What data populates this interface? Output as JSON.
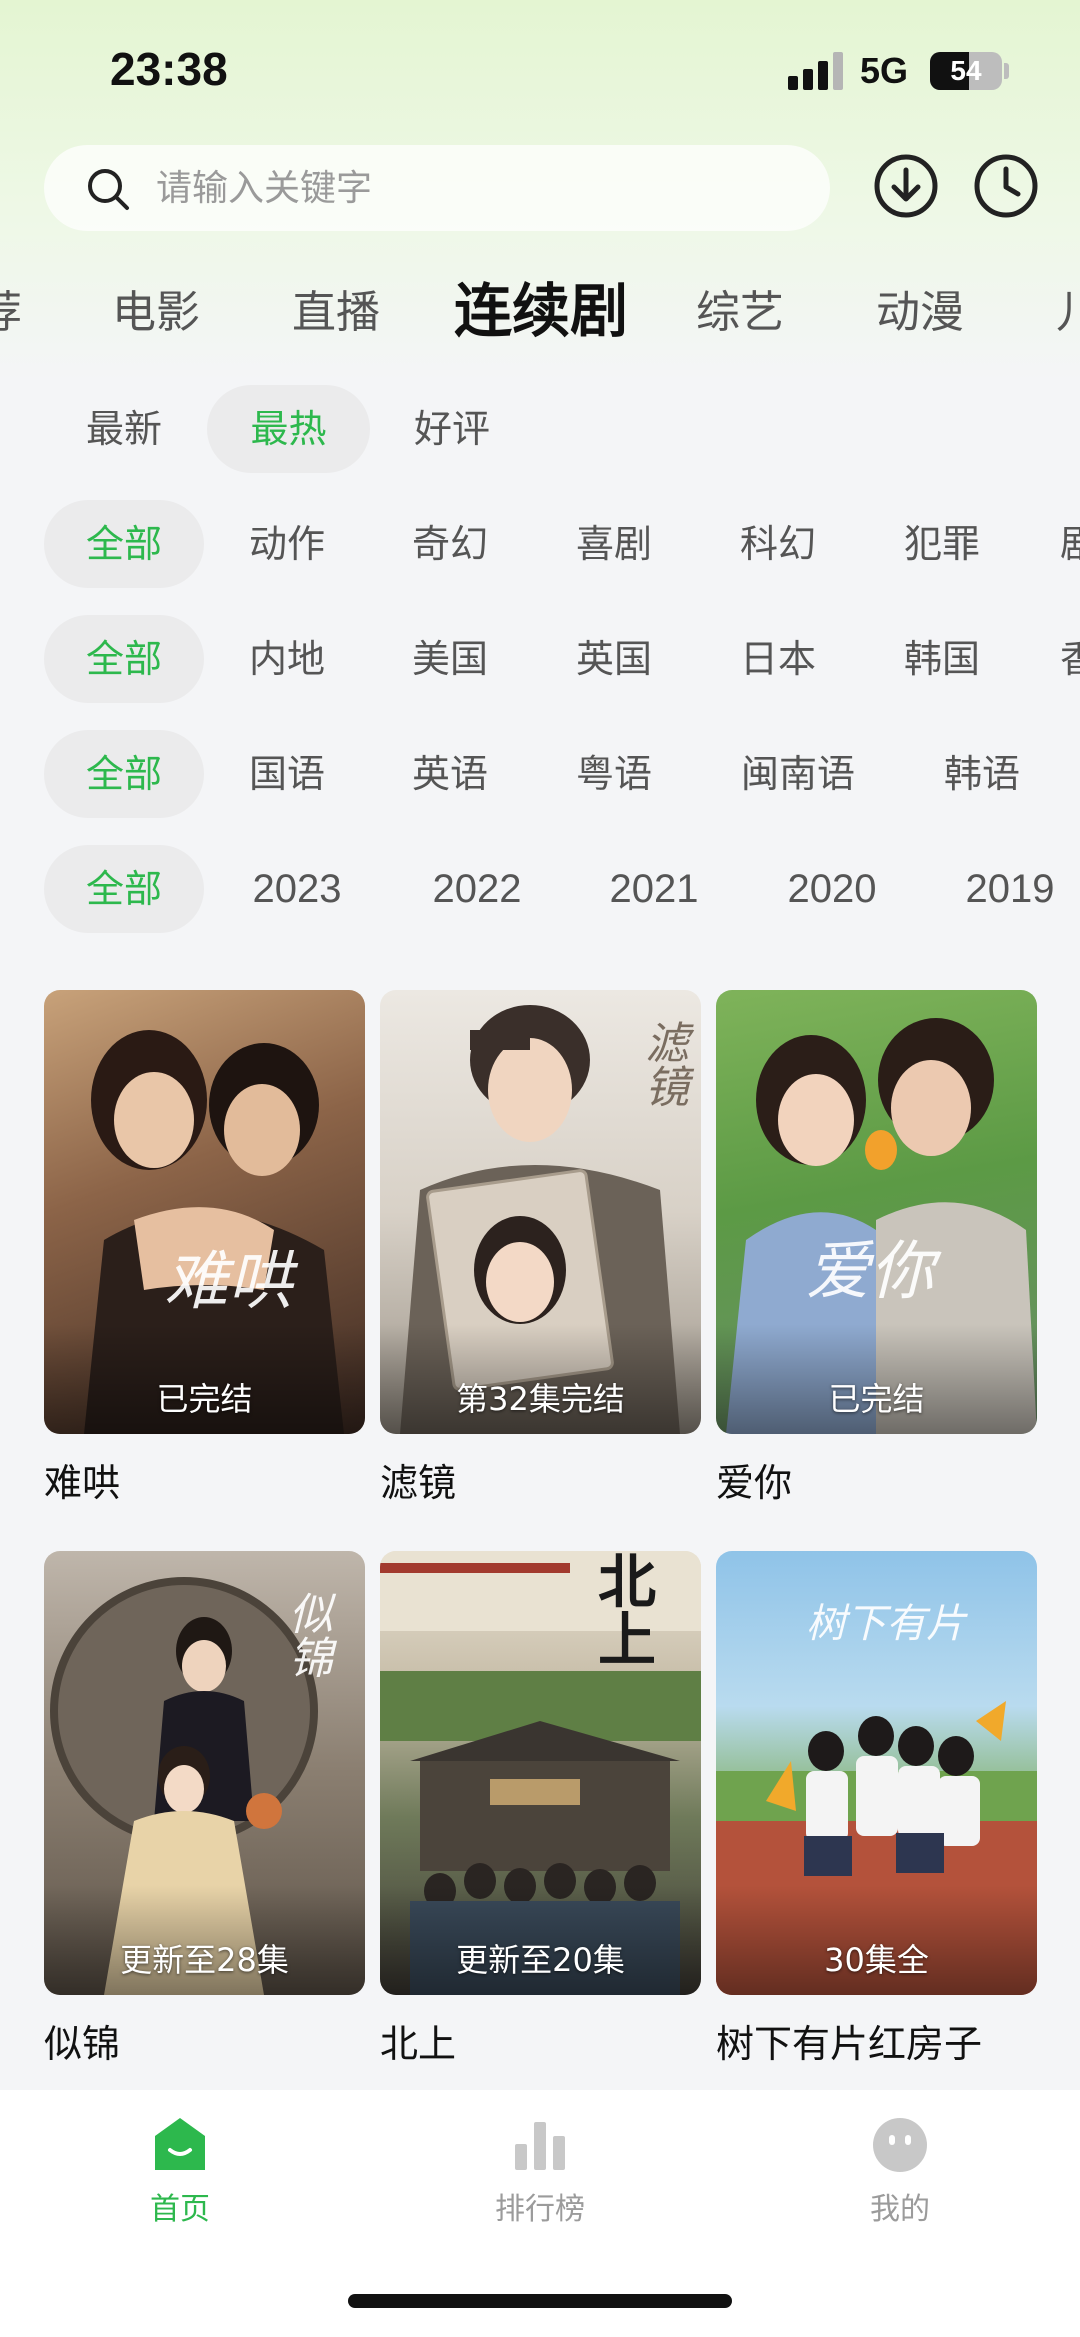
{
  "status_bar": {
    "time": "23:38",
    "network": "5G",
    "battery": "54",
    "battery_level": 0.54
  },
  "search": {
    "placeholder": "请输入关键字",
    "value": ""
  },
  "header_icons": [
    "download-icon",
    "history-clock-icon"
  ],
  "main_tabs": [
    "荐",
    "电影",
    "直播",
    "连续剧",
    "综艺",
    "动漫",
    "儿"
  ],
  "main_tabs_active": "连续剧",
  "filters": {
    "sort": [
      "最新",
      "最热",
      "好评"
    ],
    "sort_active": "最热",
    "genre": [
      "全部",
      "动作",
      "奇幻",
      "喜剧",
      "科幻",
      "犯罪",
      "剧"
    ],
    "region": [
      "全部",
      "内地",
      "美国",
      "英国",
      "日本",
      "韩国",
      "香"
    ],
    "language": [
      "全部",
      "国语",
      "英语",
      "粤语",
      "闽南语",
      "韩语"
    ],
    "year": [
      "全部",
      "2023",
      "2022",
      "2021",
      "2020",
      "2019"
    ]
  },
  "cards": [
    {
      "title": "难哄",
      "status": "已完结",
      "art": "难哄"
    },
    {
      "title": "滤镜",
      "status": "第32集完结",
      "art": "滤镜"
    },
    {
      "title": "爱你",
      "status": "已完结",
      "art": "爱你"
    },
    {
      "title": "似锦",
      "status": "更新至28集",
      "art": "似锦"
    },
    {
      "title": "北上",
      "status": "更新至20集",
      "art": "北上"
    },
    {
      "title": "树下有片红房子",
      "status": "30集全",
      "art": "树下有片"
    }
  ],
  "bottom_nav": [
    {
      "label": "首页",
      "icon": "home-icon"
    },
    {
      "label": "排行榜",
      "icon": "ranking-bars-icon"
    },
    {
      "label": "我的",
      "icon": "profile-face-icon"
    }
  ],
  "bottom_nav_active": "首页",
  "colors": {
    "accent": "#2db84d",
    "chip_bg": "#ebebec",
    "page_bg": "#f4f5f7"
  }
}
